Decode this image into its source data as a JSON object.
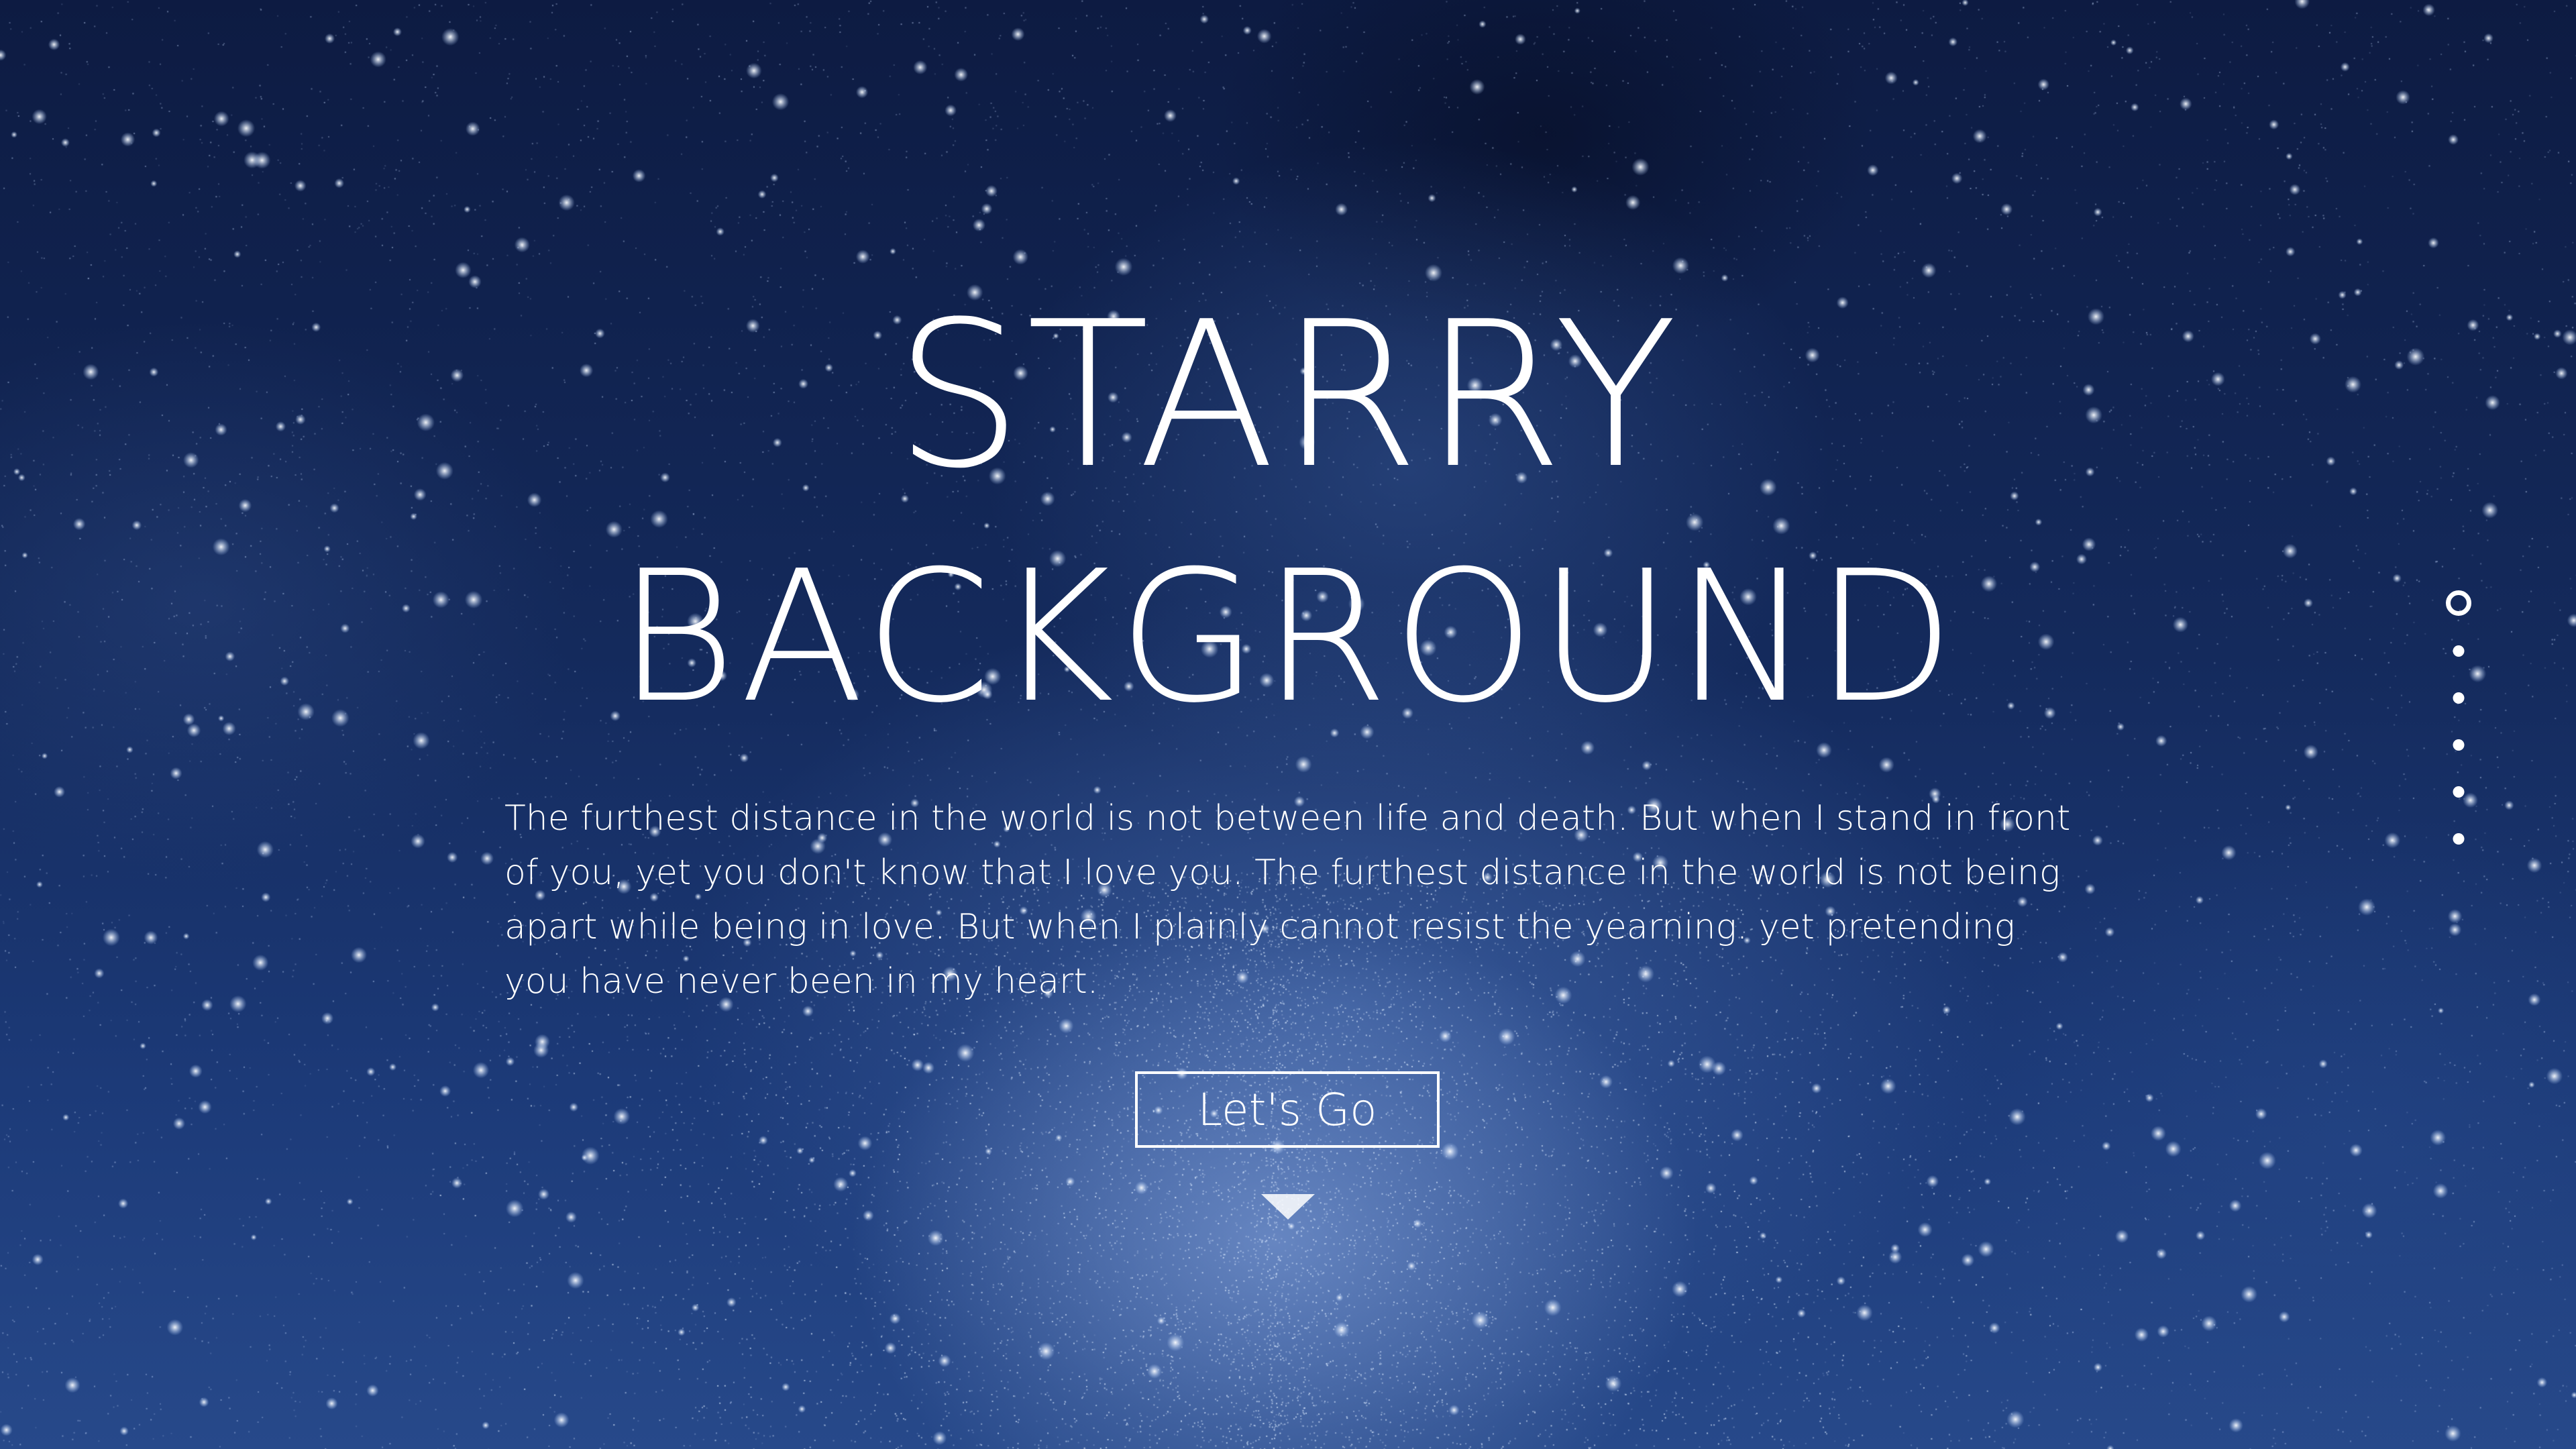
{
  "hero": {
    "title_line_1": "STARRY",
    "title_line_2": "BACKGROUND",
    "description": "The furthest distance in the world is not between life and death. But when I stand in front of you, yet you don't know that I love you. The furthest distance in the world is not being apart while being in love. But when I plainly cannot resist the yearning. yet pretending you have never been in my heart.",
    "cta_label": "Let's Go",
    "scroll_icon": "triangle-down-icon"
  },
  "pagination": {
    "total": 6,
    "active_index": 0
  },
  "colors": {
    "text": "#ffffff",
    "sky_dark": "#0d1b42",
    "sky_light": "#27498a"
  }
}
